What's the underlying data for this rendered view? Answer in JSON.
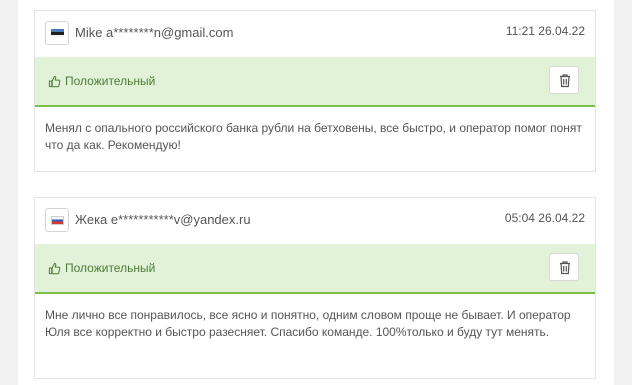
{
  "reviews": [
    {
      "flag": "estonia-flag-icon",
      "author": "Mike a********n@gmail.com",
      "datetime": "11:21 26.04.22",
      "status": "Положительный",
      "text": "Менял с опального российского банка рубли на бетховены, все быстро, и оператор помог понят что да как. Рекомендую!"
    },
    {
      "flag": "russia-flag-icon",
      "author": "Жека e***********v@yandex.ru",
      "datetime": "05:04 26.04.22",
      "status": "Положительный",
      "text": "Мне лично все понравилось, все ясно и понятно, одним словом проще не бывает. И оператор Юля все корректно и быстро разесняет. Спасибо команде. 100%только и буду тут менять."
    }
  ],
  "colors": {
    "positive_bg": "#e1f2d8",
    "positive_line": "#79c14a",
    "positive_text": "#4f7c36"
  }
}
